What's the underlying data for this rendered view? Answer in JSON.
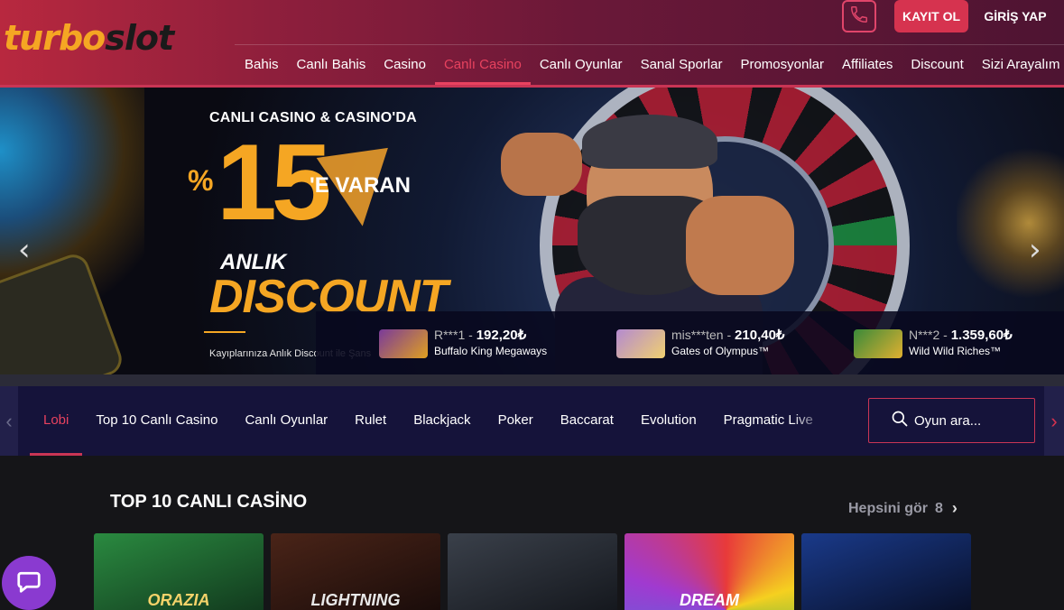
{
  "header": {
    "logo_part1": "turbo",
    "logo_part2": "slot",
    "register_label": "KAYIT OL",
    "login_label": "GİRİŞ YAP",
    "nav": [
      {
        "label": "Bahis",
        "active": false
      },
      {
        "label": "Canlı Bahis",
        "active": false
      },
      {
        "label": "Casino",
        "active": false
      },
      {
        "label": "Canlı Casino",
        "active": true
      },
      {
        "label": "Canlı Oyunlar",
        "active": false
      },
      {
        "label": "Sanal Sporlar",
        "active": false
      },
      {
        "label": "Promosyonlar",
        "active": false
      },
      {
        "label": "Affiliates",
        "active": false
      },
      {
        "label": "Discount",
        "active": false
      },
      {
        "label": "Sizi Arayalım",
        "active": false
      }
    ]
  },
  "banner": {
    "top_text": "CANLI CASINO & CASINO'DA",
    "percent": "%",
    "number": "15",
    "suffix": "'E VARAN",
    "anlik": "ANLIK",
    "discount": "DISCOUNT",
    "small_text": "Kayıplarınıza Anlık Discount ile Şans",
    "prev_arrow": "‹",
    "next_arrow": "›"
  },
  "winners": [
    {
      "user": "R***1",
      "amount": "192,20₺",
      "game": "Buffalo King Megaways",
      "thumb_color": "#7a3a9a"
    },
    {
      "user": "mis***ten",
      "amount": "210,40₺",
      "game": "Gates of Olympus™",
      "thumb_color": "#b48ad0"
    },
    {
      "user": "N***2",
      "amount": "1.359,60₺",
      "game": "Wild Wild Riches™",
      "thumb_color": "#3a8a3a"
    }
  ],
  "subnav": {
    "items": [
      {
        "label": "Lobi",
        "active": true
      },
      {
        "label": "Top 10 Canlı Casino",
        "active": false
      },
      {
        "label": "Canlı Oyunlar",
        "active": false
      },
      {
        "label": "Rulet",
        "active": false
      },
      {
        "label": "Blackjack",
        "active": false
      },
      {
        "label": "Poker",
        "active": false
      },
      {
        "label": "Baccarat",
        "active": false
      },
      {
        "label": "Evolution",
        "active": false
      },
      {
        "label": "Pragmatic Live",
        "active": false
      }
    ],
    "search_placeholder": "Oyun ara..."
  },
  "section": {
    "title": "TOP 10 CANLI CASİNO",
    "see_all": "Hepsini gör",
    "count": "8"
  },
  "cards": [
    {
      "caption": "ORAZIA",
      "bg": "#1f6a32"
    },
    {
      "caption": "LIGHTNING",
      "bg": "#3a1a14"
    },
    {
      "caption": "",
      "bg": "#2a2f38"
    },
    {
      "caption": "DREAM",
      "bg": "#5a2a8a"
    },
    {
      "caption": "",
      "bg": "#0f1e4a"
    }
  ],
  "colors": {
    "accent": "#d6334f",
    "gold": "#f5a623"
  }
}
